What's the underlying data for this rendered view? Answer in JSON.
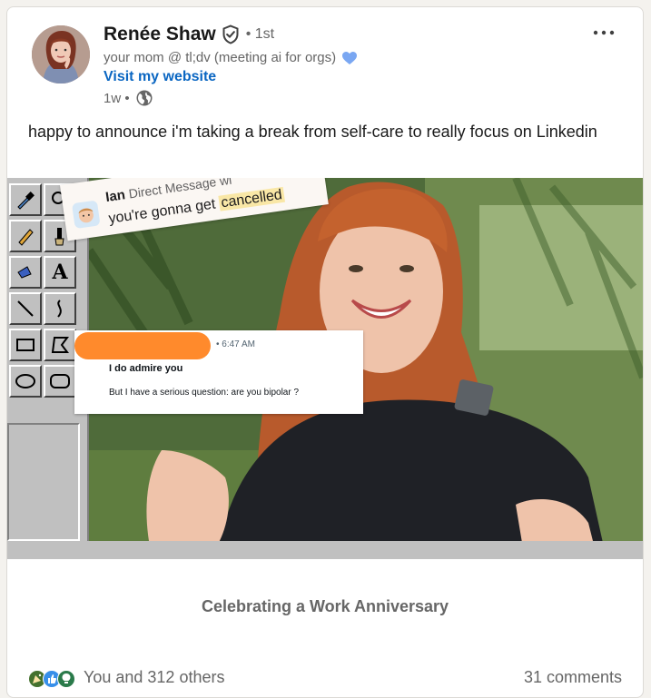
{
  "author": {
    "name": "Renée Shaw",
    "degree": "• 1st",
    "headline": "your mom @ tl;dv (meeting ai for orgs)",
    "website_label": "Visit my website",
    "posted_time": "1w •"
  },
  "post": {
    "text": "happy to announce i'm taking a break from self-care to really focus on Linkedin"
  },
  "media": {
    "dm_name": "Ian",
    "dm_subtitle": "Direct Message wi",
    "dm_message_pre": "you're gonna get ",
    "dm_message_highlight": "cancelled",
    "msg_time": "• 6:47 AM",
    "msg_line1": "I do admire you",
    "msg_line2": "But I have a serious question: are you bipolar ?",
    "paint_tool_text": "A"
  },
  "anniversary_label": "Celebrating a Work Anniversary",
  "social": {
    "reactions_text": "You and 312 others",
    "comments_text": "31 comments"
  },
  "colors": {
    "link": "#0a66c2",
    "muted": "#666666",
    "heart": "#7aa7f2",
    "redaction": "#ff8a2c",
    "highlight": "#f9e7a6"
  },
  "icons": [
    "verified-badge-icon",
    "blue-heart-icon",
    "globe-icon",
    "more-options-icon",
    "celebrate-reaction-icon",
    "like-reaction-icon",
    "insightful-reaction-icon"
  ]
}
